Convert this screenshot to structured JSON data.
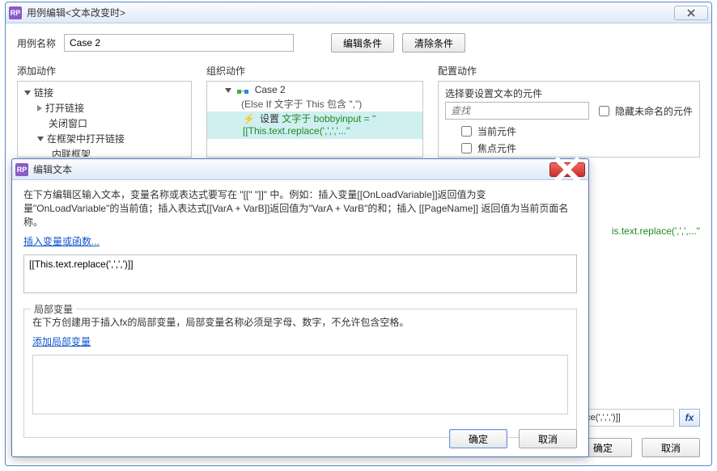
{
  "outer": {
    "title": "用例编辑<文本改变时>",
    "case_name_label": "用例名称",
    "case_name_value": "Case 2",
    "edit_condition_btn": "编辑条件",
    "clear_condition_btn": "清除条件",
    "ok_btn": "确定",
    "cancel_btn": "取消"
  },
  "add_actions": {
    "header": "添加动作",
    "links_label": "链接",
    "open_link": "打开链接",
    "close_window": "关闭窗口",
    "open_in_frame": "在框架中打开链接",
    "inline_frame": "内联框架"
  },
  "org_actions": {
    "header": "组织动作",
    "case_label": "Case 2",
    "case_cond": "(Else If 文字于 This 包含 \",\")",
    "action_prefix": "设置 ",
    "action_green": "文字于 bobbyinput = \"[[This.text.replace(',',','...\"",
    "lightning_glyph": "⚡"
  },
  "cfg": {
    "header": "配置动作",
    "subtitle": "选择要设置文本的元件",
    "search_placeholder": "查找",
    "hide_unnamed": "隐藏未命名的元件",
    "current": "当前元件",
    "focus": "焦点元件"
  },
  "peek_text": "is.text.replace(',',',...\"",
  "peek_box_text": "xt.replace(',',',')]]",
  "modal": {
    "title": "编辑文本",
    "help1": "在下方编辑区输入文本，变量名称或表达式要写在 \"[[\" \"]]\" 中。例如：插入变量[[OnLoadVariable]]返回值为变量\"OnLoadVariable\"的当前值；插入表达式[[VarA + VarB]]返回值为\"VarA + VarB\"的和；插入 [[PageName]] 返回值为当前页面名称。",
    "insert_link": "插入变量或函数...",
    "expr_value": "[[This.text.replace(',',',')]]",
    "locvar_legend": "局部变量",
    "locvar_help": "在下方创建用于插入fx的局部变量，局部变量名称必须是字母、数字，不允许包含空格。",
    "add_locvar_link": "添加局部变量",
    "ok_btn": "确定",
    "cancel_btn": "取消"
  },
  "icons": {
    "app": "RP",
    "fx": "fx"
  }
}
